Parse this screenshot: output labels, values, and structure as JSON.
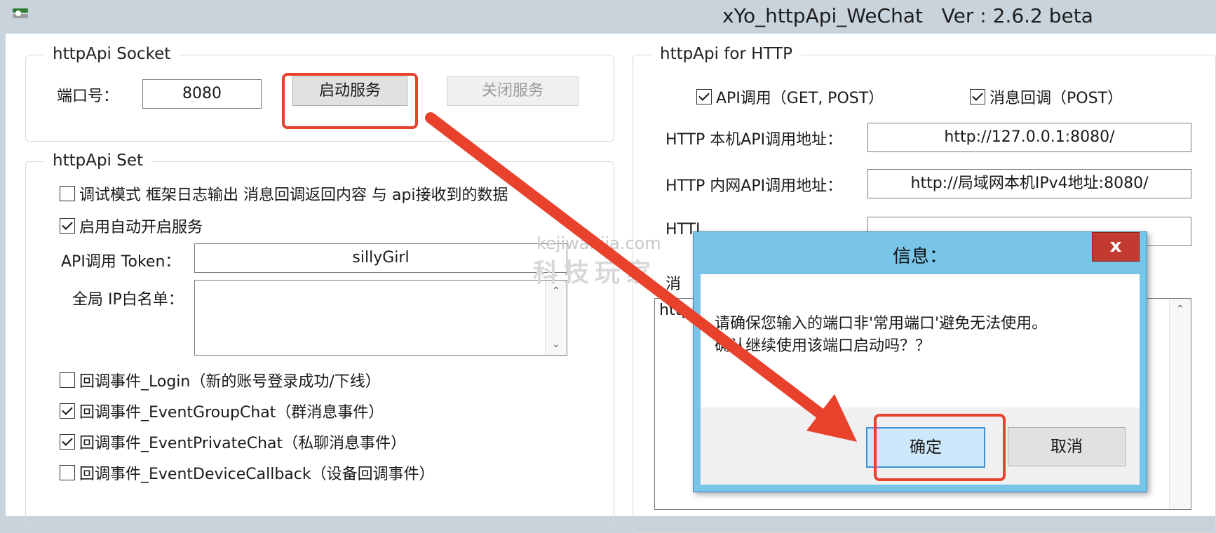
{
  "window": {
    "title": "xYo_httpApi_WeChat   Ver : 2.6.2 beta"
  },
  "socket_group": {
    "legend": "httpApi Socket",
    "port_label": "端口号：",
    "port_value": "8080",
    "start_button": "启动服务",
    "stop_button": "关闭服务"
  },
  "set_group": {
    "legend": "httpApi Set",
    "debug_mode": {
      "label": "调试模式   框架日志输出 消息回调返回内容 与 api接收到的数据",
      "checked": false
    },
    "auto_start": {
      "label": "启用自动开启服务",
      "checked": true
    },
    "token_label": "API调用 Token：",
    "token_value": "sillyGirl",
    "whitelist_label": "全局 IP白名单：",
    "whitelist_value": "",
    "callbacks": [
      {
        "label": "回调事件_Login（新的账号登录成功/下线）",
        "checked": false
      },
      {
        "label": "回调事件_EventGroupChat（群消息事件）",
        "checked": true
      },
      {
        "label": "回调事件_EventPrivateChat（私聊消息事件）",
        "checked": true
      },
      {
        "label": "回调事件_EventDeviceCallback（设备回调事件）",
        "checked": false
      }
    ]
  },
  "http_group": {
    "legend": "httpApi for HTTP",
    "api_call": {
      "label": "API调用（GET, POST）",
      "checked": true
    },
    "msg_callback": {
      "label": "消息回调（POST）",
      "checked": true
    },
    "local_addr_label": "HTTP 本机API调用地址：",
    "local_addr_value": "http://127.0.0.1:8080/",
    "lan_addr_label": "HTTP 内网API调用地址：",
    "lan_addr_value": "http://局域网本机IPv4地址:8080/",
    "third_row_label_partial": "HTTI",
    "callback_label_partial": "消",
    "textarea_value_partial": "http:"
  },
  "watermark": {
    "url": "kejiwanjia.com",
    "text": "科技玩家"
  },
  "dialog": {
    "title": "信息：",
    "close_glyph": "x",
    "message_line1": "请确保您输入的端口非'常用端口'避免无法使用。",
    "message_line2": "确认继续使用该端口启动吗？？",
    "ok_button": "确定",
    "cancel_button": "取消"
  },
  "colors": {
    "titlebar_bg": "#c9d3dc",
    "dialog_frame": "#79c5ea",
    "dialog_close": "#c33b30",
    "highlight": "#e8412c",
    "ok_button_bg": "#cde8fa"
  }
}
